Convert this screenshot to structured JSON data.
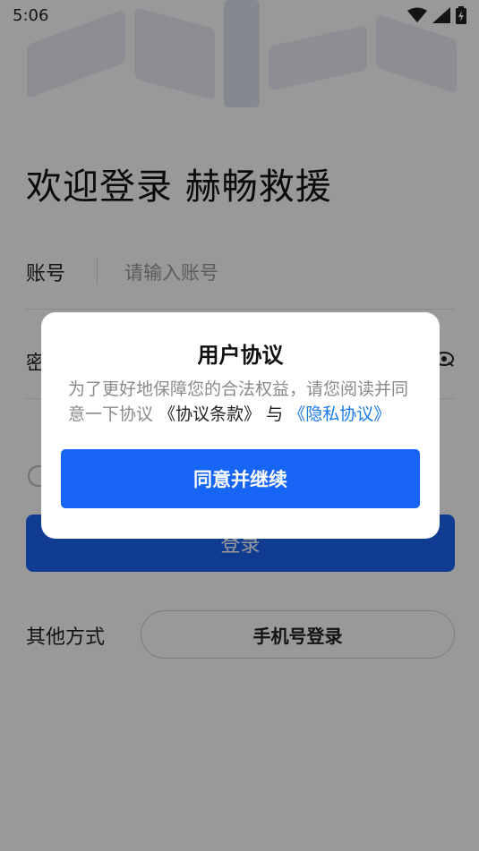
{
  "status_bar": {
    "time": "5:06"
  },
  "login": {
    "welcome": "欢迎登录 赫畅救援",
    "account_label": "账号",
    "account_placeholder": "请输入账号",
    "password_label": "密",
    "login_button": "登录",
    "other_methods_label": "其他方式",
    "phone_login_button": "手机号登录"
  },
  "dialog": {
    "title": "用户协议",
    "body_prefix": "为了更好地保障您的合法权益，请您阅读并同意一下协议",
    "terms_link": "《协议条款》",
    "connector": "与",
    "privacy_link": "《隐私协议》",
    "agree_button": "同意并继续"
  },
  "icons": {
    "wifi": "wifi-icon",
    "signal": "signal-icon",
    "battery": "battery-icon",
    "eye": "eye-icon"
  },
  "colors": {
    "primary": "#1765f4",
    "link": "#1a7bf0",
    "overlay": "rgba(0,0,0,0.40)"
  }
}
